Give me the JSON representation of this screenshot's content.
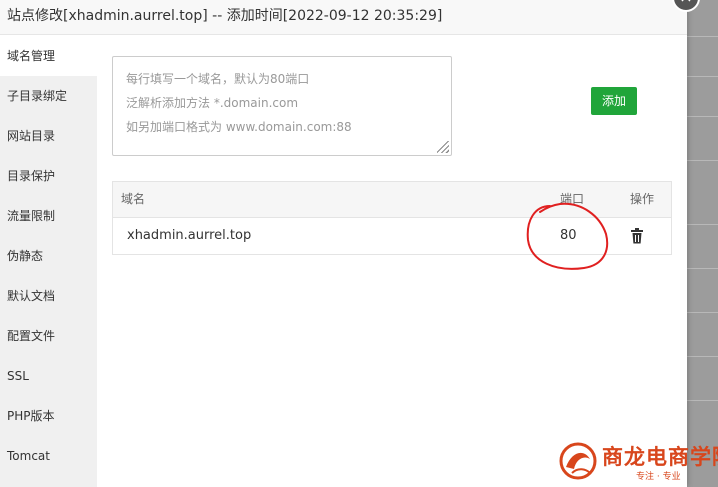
{
  "dialog": {
    "title": "站点修改[xhadmin.aurrel.top] -- 添加时间[2022-09-12 20:35:29]",
    "close_symbol": "×"
  },
  "sidebar": {
    "items": [
      {
        "label": "域名管理",
        "active": true
      },
      {
        "label": "子目录绑定"
      },
      {
        "label": "网站目录"
      },
      {
        "label": "目录保护"
      },
      {
        "label": "流量限制"
      },
      {
        "label": "伪静态"
      },
      {
        "label": "默认文档"
      },
      {
        "label": "配置文件"
      },
      {
        "label": "SSL"
      },
      {
        "label": "PHP版本"
      },
      {
        "label": "Tomcat"
      }
    ]
  },
  "domain_input": {
    "placeholder_lines": [
      "每行填写一个域名，默认为80端口",
      "泛解析添加方法 *.domain.com",
      "如另加端口格式为 www.domain.com:88"
    ],
    "value": ""
  },
  "add_button": {
    "label": "添加",
    "color": "#20a53a"
  },
  "table": {
    "headers": {
      "domain": "域名",
      "port": "端口",
      "ops": "操作"
    },
    "rows": [
      {
        "domain": "xhadmin.aurrel.top",
        "port": "80",
        "action_icon": "trash-icon"
      }
    ]
  },
  "annotation": {
    "color": "#e02020",
    "shape": "circle"
  },
  "watermark": {
    "text": "商龙电商学院",
    "sub": "专注 · 专业"
  }
}
